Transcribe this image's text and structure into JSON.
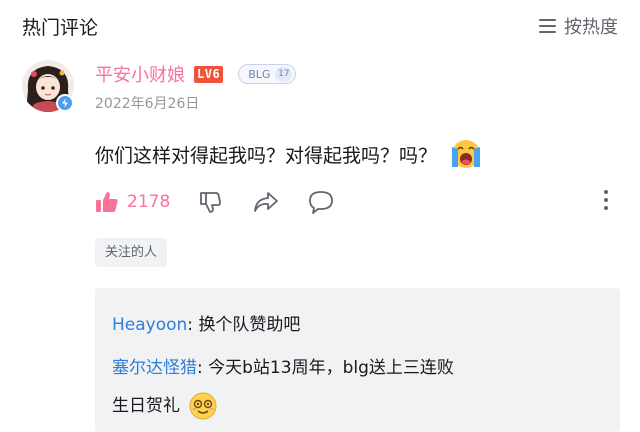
{
  "header": {
    "title": "热门评论",
    "sort_label": "按热度"
  },
  "comment": {
    "username": "平安小财娘",
    "level": "LV6",
    "medal": {
      "name": "BLG",
      "level": "17"
    },
    "date": "2022年6月26日",
    "text": "你们这样对得起我吗？对得起我吗？吗？",
    "like_count": "2178",
    "tag": "关注的人"
  },
  "replies": [
    {
      "author": "Heayoon",
      "separator": ": ",
      "text": "换个队赞助吧"
    },
    {
      "author": "塞尔达怪猎",
      "separator": ": ",
      "text": "今天b站13周年，blg送上三连败",
      "text_cont": "生日贺礼"
    }
  ],
  "colors": {
    "username": "#fb7299",
    "level_badge": "#f0523a",
    "reply_author": "#2f7fd8",
    "reply_bg": "#f1f2f3",
    "like": "#fb7299"
  },
  "icons": {
    "sort": "sort-lines-icon",
    "like": "thumbs-up-icon",
    "dislike": "thumbs-down-icon",
    "share": "share-icon",
    "reply": "reply-bubble-icon",
    "more": "more-vertical-icon",
    "emoji_cry": "crying-emoji-icon",
    "emoji_smile": "smiling-emoji-icon"
  }
}
